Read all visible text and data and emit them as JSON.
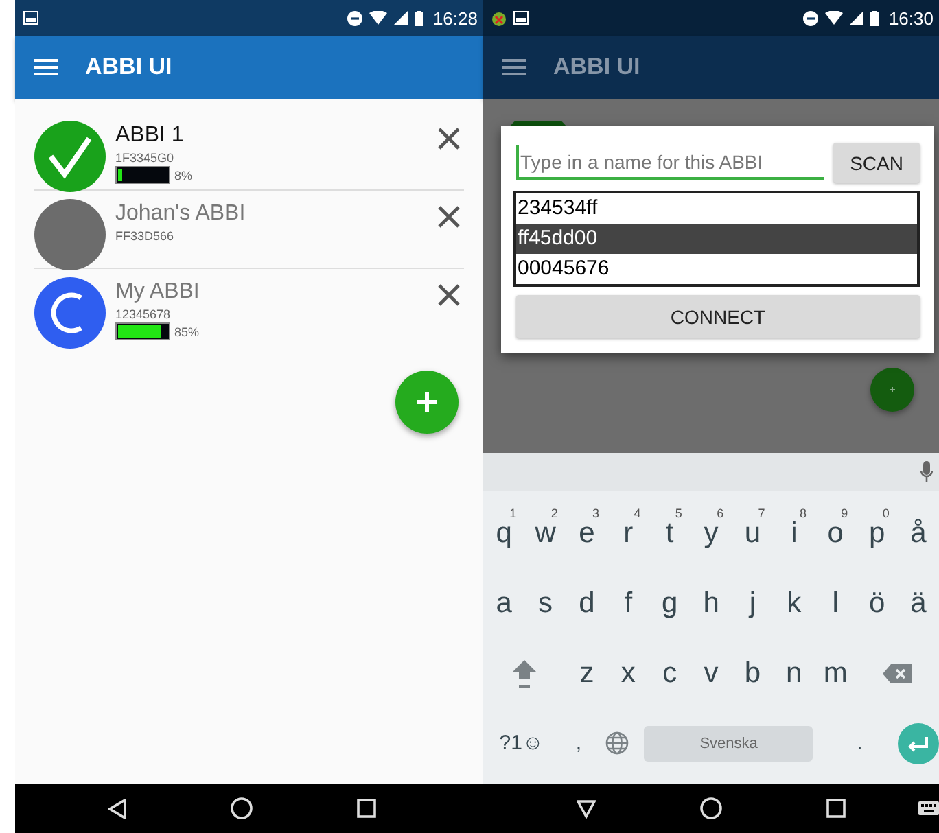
{
  "list_screen": {
    "status_time": "16:28",
    "app_title": "ABBI UI",
    "devices": [
      {
        "kind": "connected",
        "name": "ABBI 1",
        "id": "1F3345G0",
        "battery": {
          "level": 0.08,
          "reading": "8%"
        }
      },
      {
        "kind": "offline",
        "name": "Johan's ABBI",
        "id": "FF33D566"
      },
      {
        "kind": "connecting",
        "name": "My ABBI",
        "id": "12345678",
        "battery": {
          "level": 0.85,
          "reading": "85%"
        }
      }
    ]
  },
  "add_screen": {
    "status_time": "16:30",
    "app_title": "ABBI UI",
    "dialog": {
      "placeholder": "Type in a name for this ABBI",
      "scan_button": "SCAN",
      "options": [
        {
          "label": "234534ff",
          "selected": false
        },
        {
          "label": "ff45dd00",
          "selected": true
        },
        {
          "label": "00045676",
          "selected": false
        }
      ],
      "connect_button": "CONNECT"
    },
    "keyboard": {
      "letter_rows": [
        [
          {
            "kind": "char",
            "label": "q",
            "hint": "1"
          },
          {
            "kind": "char",
            "label": "w",
            "hint": "2"
          },
          {
            "kind": "char",
            "label": "e",
            "hint": "3"
          },
          {
            "kind": "char",
            "label": "r",
            "hint": "4"
          },
          {
            "kind": "char",
            "label": "t",
            "hint": "5"
          },
          {
            "kind": "char",
            "label": "y",
            "hint": "6"
          },
          {
            "kind": "char",
            "label": "u",
            "hint": "7"
          },
          {
            "kind": "char",
            "label": "i",
            "hint": "8"
          },
          {
            "kind": "char",
            "label": "o",
            "hint": "9"
          },
          {
            "kind": "char",
            "label": "p",
            "hint": "0"
          },
          {
            "kind": "char",
            "label": "å"
          }
        ],
        [
          {
            "kind": "char",
            "label": "a"
          },
          {
            "kind": "char",
            "label": "s"
          },
          {
            "kind": "char",
            "label": "d"
          },
          {
            "kind": "char",
            "label": "f"
          },
          {
            "kind": "char",
            "label": "g"
          },
          {
            "kind": "char",
            "label": "h"
          },
          {
            "kind": "char",
            "label": "j"
          },
          {
            "kind": "char",
            "label": "k"
          },
          {
            "kind": "char",
            "label": "l"
          },
          {
            "kind": "char",
            "label": "ö"
          },
          {
            "kind": "char",
            "label": "ä"
          }
        ]
      ],
      "shift_row": [
        "z",
        "x",
        "c",
        "v",
        "b",
        "n",
        "m"
      ],
      "bottom_row": {
        "symbols_key": "?1☺",
        "comma_key": ",",
        "space_key": "Svenska",
        "period_key": "."
      }
    }
  }
}
